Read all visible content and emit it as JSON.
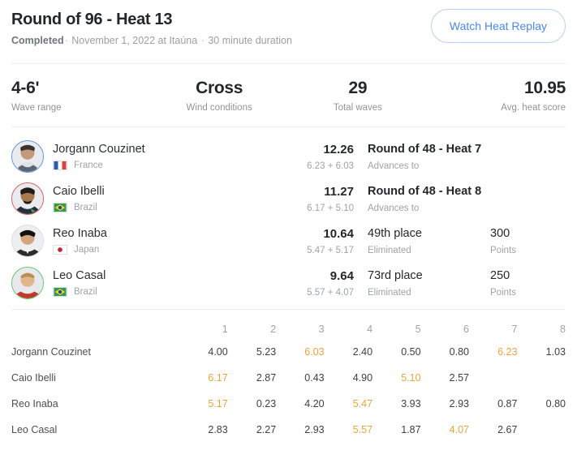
{
  "header": {
    "title": "Round of 96 - Heat 13",
    "status": "Completed",
    "sep1": "·",
    "date_location": "November 1, 2022 at Itaúna",
    "sep2": "·",
    "duration": "30 minute duration",
    "replay_button": "Watch Heat Replay"
  },
  "stats": [
    {
      "value": "4-6'",
      "label": "Wave range"
    },
    {
      "value": "Cross",
      "label": "Wind conditions"
    },
    {
      "value": "29",
      "label": "Total waves"
    },
    {
      "value": "10.95",
      "label": "Avg. heat score"
    }
  ],
  "athletes": [
    {
      "name": "Jorgann Couzinet",
      "country": "France",
      "flag": "france-flag",
      "ring_color": "#5b8fe8",
      "total": "12.26",
      "breakdown": "6.23 + 6.03",
      "result": "Round of 48 - Heat 7",
      "result_sub": "Advances to",
      "points": "",
      "points_label": ""
    },
    {
      "name": "Caio Ibelli",
      "country": "Brazil",
      "flag": "brazil-flag",
      "ring_color": "#e05a5a",
      "total": "11.27",
      "breakdown": "6.17 + 5.10",
      "result": "Round of 48 - Heat 8",
      "result_sub": "Advances to",
      "points": "",
      "points_label": ""
    },
    {
      "name": "Reo Inaba",
      "country": "Japan",
      "flag": "japan-flag",
      "ring_color": "#d9dbdf",
      "total": "10.64",
      "breakdown": "5.47 + 5.17",
      "result": "49th place",
      "result_sub": "Eliminated",
      "points": "300",
      "points_label": "Points"
    },
    {
      "name": "Leo Casal",
      "country": "Brazil",
      "flag": "brazil-flag",
      "ring_color": "#5fc46a",
      "total": "9.64",
      "breakdown": "5.57 + 4.07",
      "result": "73rd place",
      "result_sub": "Eliminated",
      "points": "250",
      "points_label": "Points"
    }
  ],
  "wave_table": {
    "name_header": "",
    "columns": [
      "1",
      "2",
      "3",
      "4",
      "5",
      "6",
      "7",
      "8"
    ],
    "rows": [
      {
        "name": "Jorgann Couzinet",
        "scores": [
          "4.00",
          "5.23",
          "6.03",
          "2.40",
          "0.50",
          "0.80",
          "6.23",
          "1.03"
        ],
        "best": [
          false,
          false,
          true,
          false,
          false,
          false,
          true,
          false
        ]
      },
      {
        "name": "Caio Ibelli",
        "scores": [
          "6.17",
          "2.87",
          "0.43",
          "4.90",
          "5.10",
          "2.57",
          "",
          ""
        ],
        "best": [
          true,
          false,
          false,
          false,
          true,
          false,
          false,
          false
        ]
      },
      {
        "name": "Reo Inaba",
        "scores": [
          "5.17",
          "0.23",
          "4.20",
          "5.47",
          "3.93",
          "2.93",
          "0.87",
          "0.80"
        ],
        "best": [
          true,
          false,
          false,
          true,
          false,
          false,
          false,
          false
        ]
      },
      {
        "name": "Leo Casal",
        "scores": [
          "2.83",
          "2.27",
          "2.93",
          "5.57",
          "1.87",
          "4.07",
          "2.67",
          ""
        ],
        "best": [
          false,
          false,
          false,
          true,
          false,
          true,
          false,
          false
        ]
      }
    ]
  },
  "colors": {
    "accent_blue": "#4a89f0",
    "highlight_orange": "#f0a33c",
    "rank_1": "#5b8fe8",
    "rank_2": "#e05a5a",
    "rank_3": "#d9dbdf",
    "rank_4": "#5fc46a",
    "text_primary": "#23272b",
    "text_muted": "#9ea3a9"
  }
}
